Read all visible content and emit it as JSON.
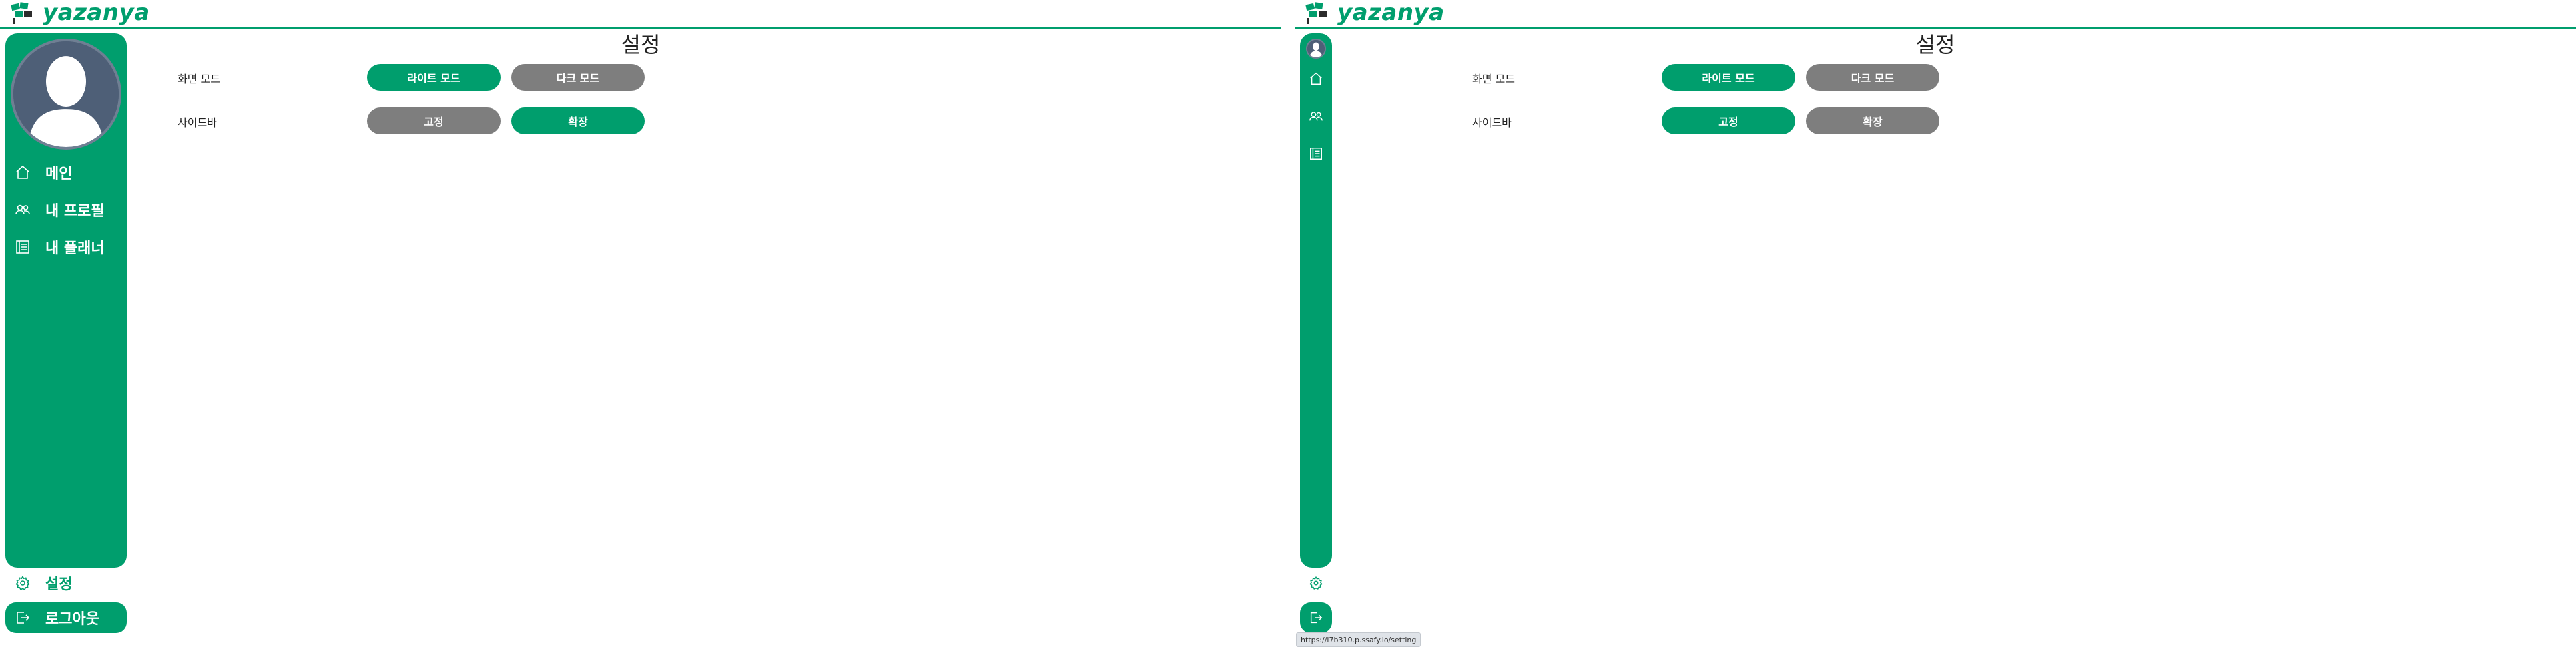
{
  "brand": {
    "name": "yazanya",
    "color": "#009e6d"
  },
  "page": {
    "title": "설정"
  },
  "nav": {
    "home_label": "메인",
    "profile_label": "내 프로필",
    "planner_label": "내 플래너",
    "settings_label": "설정",
    "logout_label": "로그아웃"
  },
  "settings": {
    "screen_mode": {
      "label": "화면 모드",
      "options": [
        "라이트 모드",
        "다크 모드"
      ]
    },
    "sidebar": {
      "label": "사이드바",
      "options": [
        "고정",
        "확장"
      ]
    }
  },
  "states": {
    "left": {
      "screen_mode_selected": "라이트 모드",
      "sidebar_selected": "확장",
      "sidebar_state": "expanded"
    },
    "right": {
      "screen_mode_selected": "라이트 모드",
      "sidebar_selected": "고정",
      "sidebar_state": "collapsed"
    }
  },
  "status_bar": {
    "url": "https://i7b310.p.ssafy.io/setting"
  },
  "colors": {
    "primary": "#009e6d",
    "inactive": "#7e7e7e",
    "avatar_bg": "#4e5f77"
  },
  "icons": [
    "home-icon",
    "users-icon",
    "planner-icon",
    "gear-icon",
    "logout-icon",
    "avatar-icon",
    "logo-icon"
  ]
}
